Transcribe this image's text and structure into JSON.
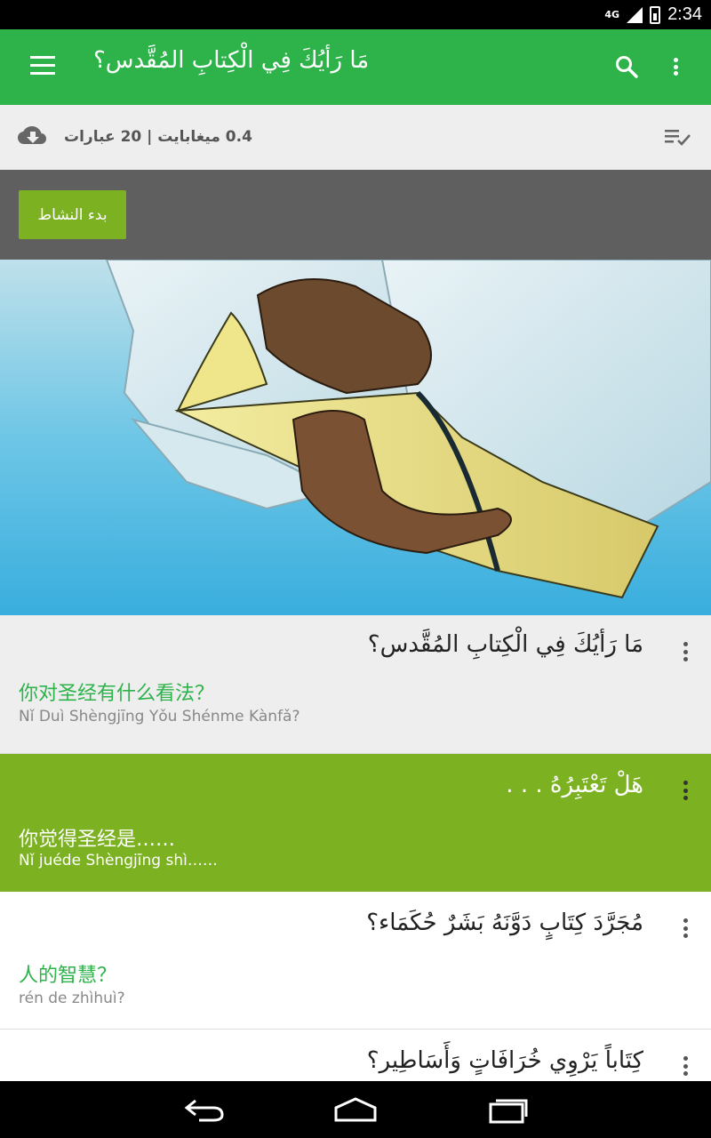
{
  "status_bar": {
    "network": "4G",
    "time": "2:34"
  },
  "app_bar": {
    "title": "مَا رَأيُكَ فِي الْكِتابِ المُقَّدس؟",
    "menu_icon": "hamburger-menu-icon",
    "search_icon": "search-icon",
    "more_icon": "more-vert-icon"
  },
  "info_bar": {
    "meta": "0.4 ميغابايت | 20 عبارات",
    "download_icon": "cloud-download-icon",
    "playlist_icon": "playlist-check-icon"
  },
  "activity": {
    "start_label": "بدء النشاط"
  },
  "hero": {
    "image": "hands-holding-open-bible-illustration"
  },
  "phrases": [
    {
      "arabic": "مَا رَأيُكَ فِي الْكِتابِ المُقَّدس؟",
      "chinese": "你对圣经有什么看法？",
      "pinyin": "Nǐ Duì Shèngjīng Yǒu Shénme Kànfǎ?"
    },
    {
      "arabic": "هَلْ تَعْتَبِرُهُ . . .",
      "chinese": "你觉得圣经是……",
      "pinyin": "Nǐ juéde Shèngjīng shì……"
    },
    {
      "arabic": "مُجَرَّدَ كِتَابٍ دَوَّنَهُ بَشَرٌ حُكَمَاء؟",
      "chinese": "人的智慧？",
      "pinyin": "rén de zhìhuì?"
    },
    {
      "arabic": "كِتَاباً يَرْوِي خُرَافَاتٍ وَأَسَاطِير؟"
    }
  ],
  "nav_bar": {
    "back_icon": "back-icon",
    "home_icon": "home-icon",
    "recents_icon": "recents-icon"
  },
  "colors": {
    "app_bar": "#2db34a",
    "accent_green": "#7cb221",
    "activity_bar": "#5f5f5f",
    "info_bar": "#eeeeee"
  }
}
